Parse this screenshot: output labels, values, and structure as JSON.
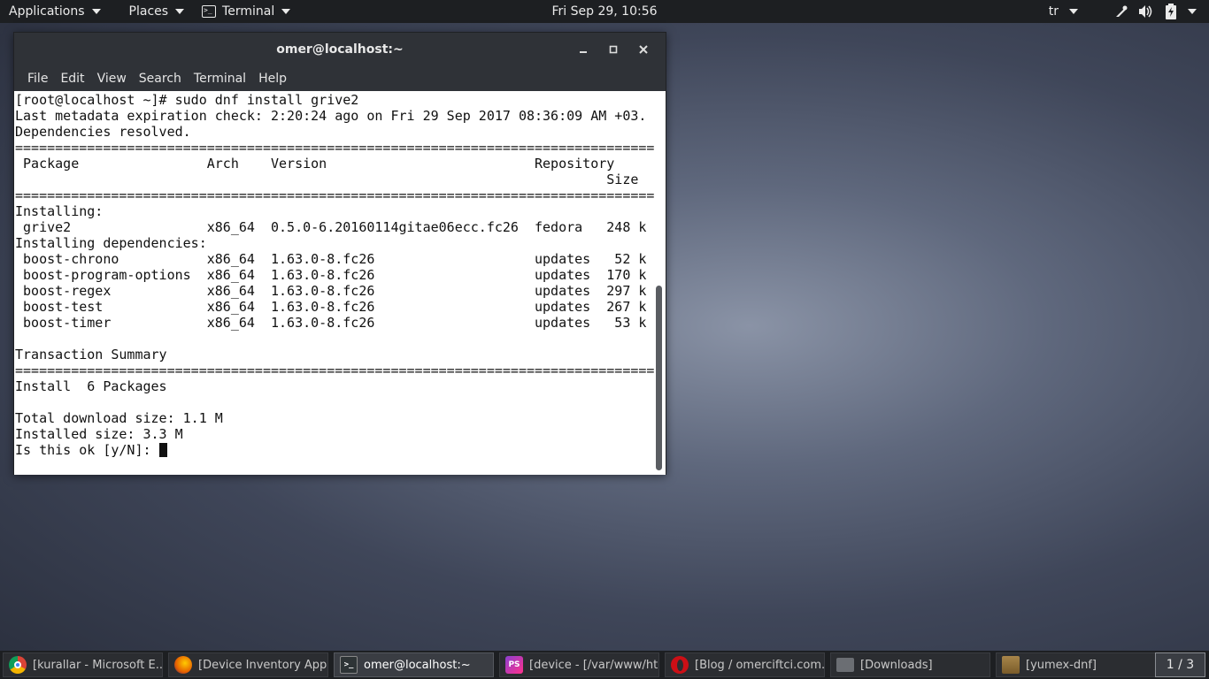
{
  "top_panel": {
    "applications_label": "Applications",
    "places_label": "Places",
    "terminal_label": "Terminal",
    "clock": "Fri Sep 29, 10:56",
    "language": "tr"
  },
  "window": {
    "title": "omer@localhost:~",
    "menu": [
      "File",
      "Edit",
      "View",
      "Search",
      "Terminal",
      "Help"
    ]
  },
  "terminal": {
    "lines": [
      "[root@localhost ~]# sudo dnf install grive2",
      "Last metadata expiration check: 2:20:24 ago on Fri 29 Sep 2017 08:36:09 AM +03.",
      "Dependencies resolved.",
      "================================================================================",
      " Package                Arch    Version                          Repository",
      "                                                                          Size",
      "================================================================================",
      "Installing:",
      " grive2                 x86_64  0.5.0-6.20160114gitae06ecc.fc26  fedora   248 k",
      "Installing dependencies:",
      " boost-chrono           x86_64  1.63.0-8.fc26                    updates   52 k",
      " boost-program-options  x86_64  1.63.0-8.fc26                    updates  170 k",
      " boost-regex            x86_64  1.63.0-8.fc26                    updates  297 k",
      " boost-test             x86_64  1.63.0-8.fc26                    updates  267 k",
      " boost-timer            x86_64  1.63.0-8.fc26                    updates   53 k",
      "",
      "Transaction Summary",
      "================================================================================",
      "Install  6 Packages",
      "",
      "Total download size: 1.1 M",
      "Installed size: 3.3 M"
    ],
    "prompt": "Is this ok [y/N]: "
  },
  "taskbar": {
    "tasks": [
      {
        "label": "[kurallar - Microsoft E...",
        "icon": "chrome-icon",
        "color": "#db4437"
      },
      {
        "label": "[Device Inventory Appli...",
        "icon": "firefox-icon",
        "color": "#e66000"
      },
      {
        "label": "omer@localhost:~",
        "icon": "terminal-icon",
        "color": "#2e3436"
      },
      {
        "label": "[device - [/var/www/ht...",
        "icon": "phpstorm-icon",
        "color": "#8b3fd0"
      },
      {
        "label": "[Blog / omerciftci.com...",
        "icon": "opera-icon",
        "color": "#cc0f16"
      },
      {
        "label": "[Downloads]",
        "icon": "folder-icon",
        "color": "#6b6e73"
      },
      {
        "label": "[yumex-dnf]",
        "icon": "package-icon",
        "color": "#8a6d3b"
      }
    ],
    "pager": "1 / 3"
  }
}
